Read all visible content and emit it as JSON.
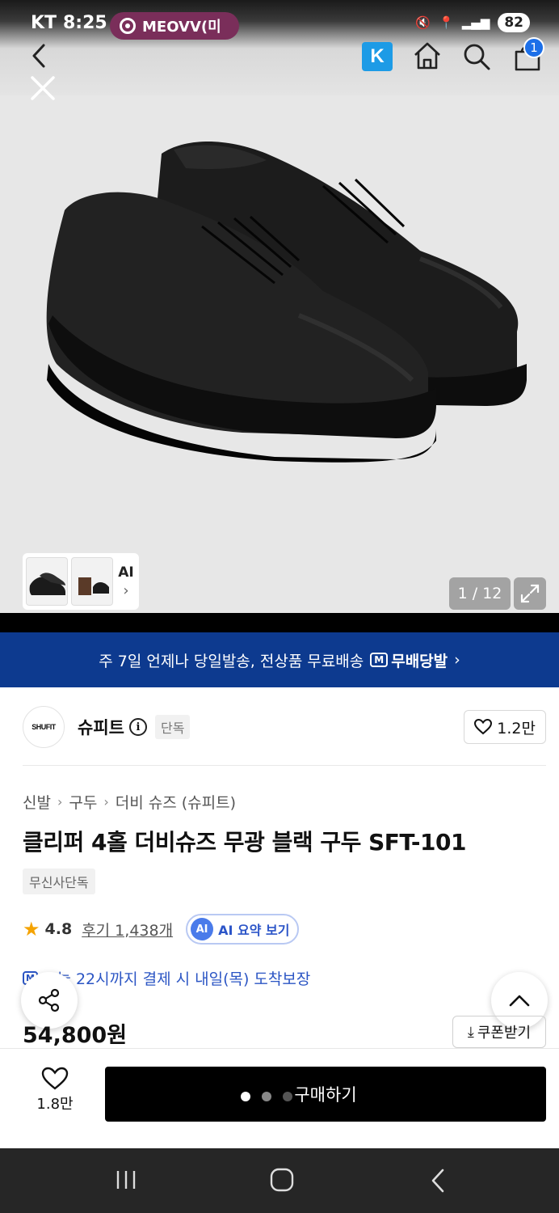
{
  "status_bar": {
    "carrier": "KT",
    "time": "8:25",
    "media_app": "MEOVV(미",
    "battery": "82"
  },
  "header": {
    "k_label": "K",
    "cart_count": "1"
  },
  "gallery": {
    "ai_label": "AI",
    "ai_chevron": "›",
    "counter": "1 / 12"
  },
  "promo": {
    "text": "주 7일 언제나 당일발송, 전상품 무료배송",
    "badge_icon_text": "M",
    "badge_label": "무배당발",
    "chevron": "›"
  },
  "brand": {
    "logo_text": "SHUFIT",
    "name": "슈피트",
    "info_symbol": "i",
    "tag": "단독",
    "likes": "1.2만"
  },
  "breadcrumb": {
    "items": [
      "신발",
      "구두",
      "더비 슈즈 (슈피트)"
    ],
    "separator": "›"
  },
  "product": {
    "title": "클리퍼 4홀 더비슈즈 무광 블랙 구두 SFT-101",
    "exclusive_tag": "무신사단독",
    "rating": "4.8",
    "reviews": "후기 1,438개",
    "ai_badge": "AI",
    "ai_summary": "AI 요약 보기",
    "delivery_icon_text": "M",
    "delivery": "오늘 22시까지 결제 시 내일(목) 도착보장",
    "price": "54,800원",
    "coupon": "쿠폰받기",
    "coupon_icon": "⤓"
  },
  "bottom": {
    "wish_count": "1.8만",
    "buy_label": "구매하기"
  },
  "colors": {
    "promo_bg": "#0d3a8f",
    "accent_blue": "#2b55c4",
    "star": "#f5a300",
    "buy_bg": "#000000"
  }
}
